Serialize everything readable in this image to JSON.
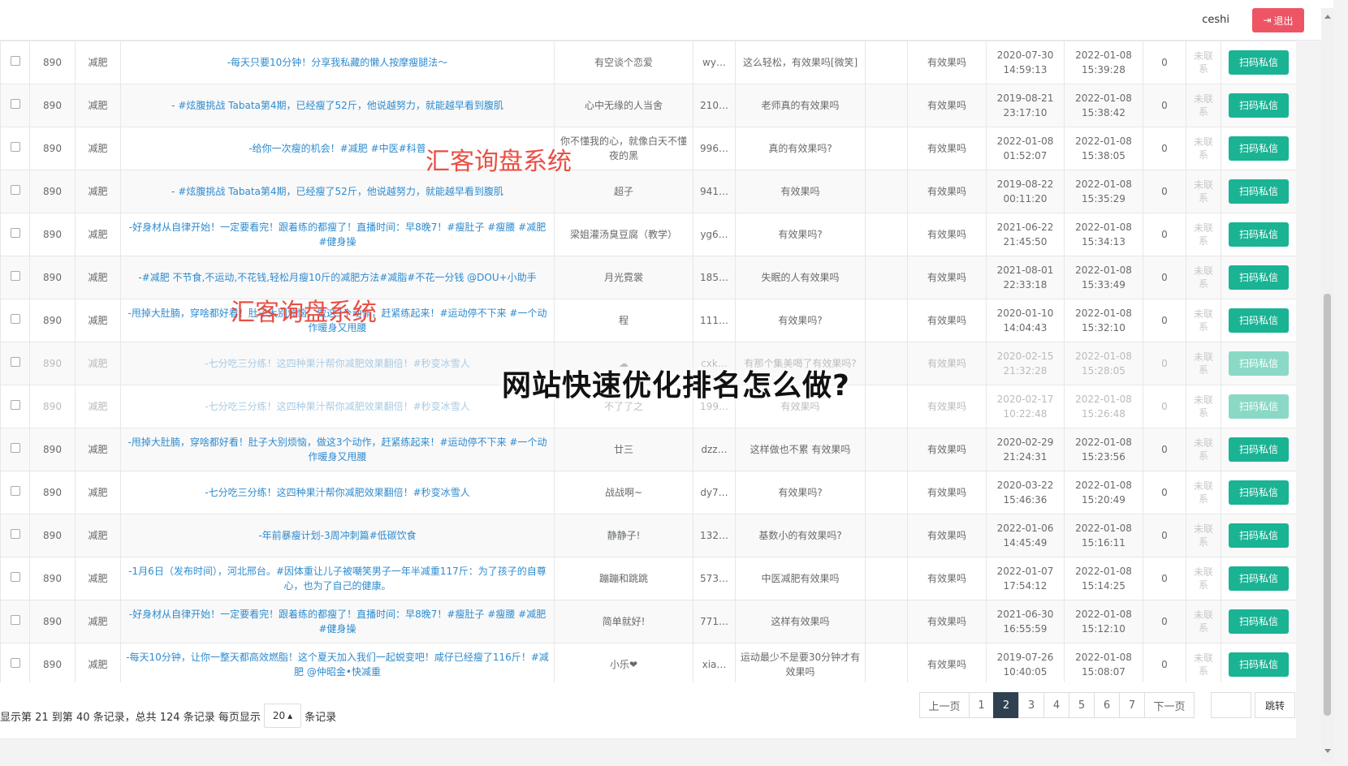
{
  "topbar": {
    "user": "ceshi",
    "logout_label": "退出"
  },
  "rows": [
    {
      "id": "890",
      "cat": "减肥",
      "title": "-每天只要10分钟！分享我私藏的懒人按摩瘦腿法～",
      "nick": "有空谈个恋爱",
      "uid": "wy…",
      "comment": "这么轻松，有效果吗[微笑]",
      "tag": "有效果吗",
      "t1a": "2020-07-30",
      "t1b": "14:59:13",
      "t2a": "2022-01-08",
      "t2b": "15:39:28",
      "count": "0",
      "status": "未联系",
      "action": "扫码私信"
    },
    {
      "id": "890",
      "cat": "减肥",
      "title": "- #炫腹挑战 Tabata第4期，已经瘦了52斤，他说越努力，就能越早看到腹肌",
      "nick": "心中无缘的人当舍",
      "uid": "210…",
      "comment": "老师真的有效果吗",
      "tag": "有效果吗",
      "t1a": "2019-08-21",
      "t1b": "23:17:10",
      "t2a": "2022-01-08",
      "t2b": "15:38:42",
      "count": "0",
      "status": "未联系",
      "action": "扫码私信"
    },
    {
      "id": "890",
      "cat": "减肥",
      "title": "-给你一次瘦的机会！#减肥 #中医#科普",
      "nick": "你不懂我的心，就像白天不懂夜的黑",
      "uid": "996…",
      "comment": "真的有效果吗?",
      "tag": "有效果吗",
      "t1a": "2022-01-08",
      "t1b": "01:52:07",
      "t2a": "2022-01-08",
      "t2b": "15:38:05",
      "count": "0",
      "status": "未联系",
      "action": "扫码私信"
    },
    {
      "id": "890",
      "cat": "减肥",
      "title": "- #炫腹挑战 Tabata第4期，已经瘦了52斤，他说越努力，就能越早看到腹肌",
      "nick": "超子",
      "uid": "941…",
      "comment": "有效果吗",
      "tag": "有效果吗",
      "t1a": "2019-08-22",
      "t1b": "00:11:20",
      "t2a": "2022-01-08",
      "t2b": "15:35:29",
      "count": "0",
      "status": "未联系",
      "action": "扫码私信"
    },
    {
      "id": "890",
      "cat": "减肥",
      "title": "-好身材从自律开始！一定要看完！跟着练的都瘦了！直播时间：早8晚7！#瘦肚子 #瘦腰 #减肥 #健身操",
      "nick": "梁姐灌汤臭豆腐（教学）",
      "uid": "yg6…",
      "comment": "有效果吗?",
      "tag": "有效果吗",
      "t1a": "2021-06-22",
      "t1b": "21:45:50",
      "t2a": "2022-01-08",
      "t2b": "15:34:13",
      "count": "0",
      "status": "未联系",
      "action": "扫码私信"
    },
    {
      "id": "890",
      "cat": "减肥",
      "title": "-#减肥 不节食,不运动,不花钱,轻松月瘦10斤的减肥方法#减脂#不花一分钱 @DOU+小助手",
      "nick": "月光霓裳",
      "uid": "185…",
      "comment": "失眠的人有效果吗",
      "tag": "有效果吗",
      "t1a": "2021-08-01",
      "t1b": "22:33:18",
      "t2a": "2022-01-08",
      "t2b": "15:33:49",
      "count": "0",
      "status": "未联系",
      "action": "扫码私信"
    },
    {
      "id": "890",
      "cat": "减肥",
      "title": "-甩掉大肚腩，穿啥都好看！肚子大别烦恼，做这3个动作，赶紧练起来！#运动停不下来 #一个动作暖身又甩腰",
      "nick": "程",
      "uid": "111…",
      "comment": "有效果吗?",
      "tag": "有效果吗",
      "t1a": "2020-01-10",
      "t1b": "14:04:43",
      "t2a": "2022-01-08",
      "t2b": "15:32:10",
      "count": "0",
      "status": "未联系",
      "action": "扫码私信"
    },
    {
      "id": "890",
      "cat": "减肥",
      "title": "-七分吃三分练！这四种果汁帮你减肥效果翻倍！#秒变冰雪人",
      "nick": "☁",
      "uid": "cxk…",
      "comment": "有那个集美喝了有效果吗?",
      "tag": "有效果吗",
      "t1a": "2020-02-15",
      "t1b": "21:32:28",
      "t2a": "2022-01-08",
      "t2b": "15:28:05",
      "count": "0",
      "status": "未联系",
      "action": "扫码私信",
      "faded": true
    },
    {
      "id": "890",
      "cat": "减肥",
      "title": "-七分吃三分练！这四种果汁帮你减肥效果翻倍！#秒变冰雪人",
      "nick": "不了了之",
      "uid": "199…",
      "comment": "有效果吗",
      "tag": "有效果吗",
      "t1a": "2020-02-17",
      "t1b": "10:22:48",
      "t2a": "2022-01-08",
      "t2b": "15:26:48",
      "count": "0",
      "status": "未联系",
      "action": "扫码私信",
      "faded": true
    },
    {
      "id": "890",
      "cat": "减肥",
      "title": "-甩掉大肚腩，穿啥都好看！肚子大别烦恼，做这3个动作，赶紧练起来！#运动停不下来 #一个动作暖身又甩腰",
      "nick": "廿三",
      "uid": "dzz…",
      "comment": "这样做也不累 有效果吗",
      "tag": "有效果吗",
      "t1a": "2020-02-29",
      "t1b": "21:24:31",
      "t2a": "2022-01-08",
      "t2b": "15:23:56",
      "count": "0",
      "status": "未联系",
      "action": "扫码私信"
    },
    {
      "id": "890",
      "cat": "减肥",
      "title": "-七分吃三分练！这四种果汁帮你减肥效果翻倍！#秒变冰雪人",
      "nick": "战战啊~",
      "uid": "dy7…",
      "comment": "有效果吗?",
      "tag": "有效果吗",
      "t1a": "2020-03-22",
      "t1b": "15:46:36",
      "t2a": "2022-01-08",
      "t2b": "15:20:49",
      "count": "0",
      "status": "未联系",
      "action": "扫码私信"
    },
    {
      "id": "890",
      "cat": "减肥",
      "title": "-年前暴瘦计划-3周冲刺篇#低碳饮食",
      "nick": "静静子!",
      "uid": "132…",
      "comment": "基数小的有效果吗?",
      "tag": "有效果吗",
      "t1a": "2022-01-06",
      "t1b": "14:45:49",
      "t2a": "2022-01-08",
      "t2b": "15:16:11",
      "count": "0",
      "status": "未联系",
      "action": "扫码私信"
    },
    {
      "id": "890",
      "cat": "减肥",
      "title": "-1月6日（发布时间），河北邢台。#因体重让儿子被嘲笑男子一年半减重117斤：为了孩子的自尊心，也为了自己的健康。",
      "nick": "蹦蹦和跳跳",
      "uid": "573…",
      "comment": "中医减肥有效果吗",
      "tag": "有效果吗",
      "t1a": "2022-01-07",
      "t1b": "17:54:12",
      "t2a": "2022-01-08",
      "t2b": "15:14:25",
      "count": "0",
      "status": "未联系",
      "action": "扫码私信"
    },
    {
      "id": "890",
      "cat": "减肥",
      "title": "-好身材从自律开始！一定要看完！跟着练的都瘦了！直播时间：早8晚7！#瘦肚子 #瘦腰 #减肥 #健身操",
      "nick": "简单就好!",
      "uid": "771…",
      "comment": "这样有效果吗",
      "tag": "有效果吗",
      "t1a": "2021-06-30",
      "t1b": "16:55:59",
      "t2a": "2022-01-08",
      "t2b": "15:12:10",
      "count": "0",
      "status": "未联系",
      "action": "扫码私信"
    },
    {
      "id": "890",
      "cat": "减肥",
      "title": "-每天10分钟，让你一整天都高效燃脂！这个夏天加入我们一起蜕变吧！咸仔已经瘦了116斤！#减肥 @仲昭金•快减重",
      "nick": "小乐❤",
      "uid": "xia…",
      "comment": "运动最少不是要30分钟才有效果吗",
      "tag": "有效果吗",
      "t1a": "2019-07-26",
      "t1b": "10:40:05",
      "t2a": "2022-01-08",
      "t2b": "15:08:07",
      "count": "0",
      "status": "未联系",
      "action": "扫码私信"
    }
  ],
  "pagination": {
    "info_prefix": "显示第 21 到第 40 条记录，总共 124 条记录 每页显示",
    "page_size": "20",
    "info_suffix": "条记录",
    "prev": "上一页",
    "pages": [
      "1",
      "2",
      "3",
      "4",
      "5",
      "6",
      "7"
    ],
    "active_page": "2",
    "next": "下一页",
    "jump": "跳转"
  },
  "watermarks": [
    "汇客询盘系统",
    "汇客询盘系统"
  ],
  "headline": "网站快速优化排名怎么做?",
  "colors": {
    "accent_green": "#1ab394",
    "danger_red": "#ed5565",
    "link_blue": "#2e8bcf",
    "active_page": "#2f4050"
  }
}
